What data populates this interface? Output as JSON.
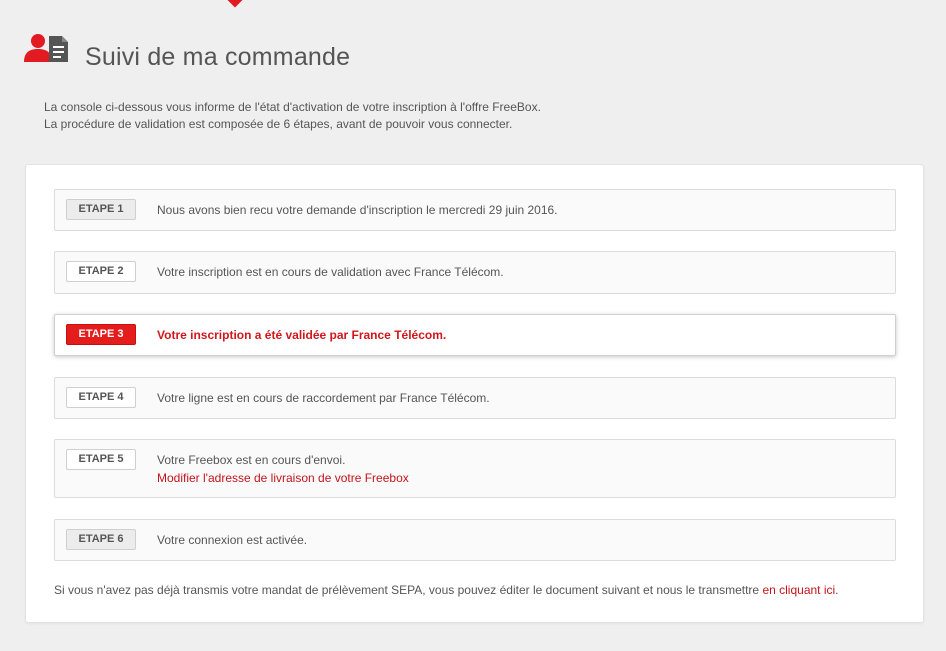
{
  "header": {
    "title": "Suivi de ma commande",
    "icon": "user-document-icon",
    "accent_color": "#e21a22"
  },
  "intro": {
    "line1": "La console ci-dessous vous informe de l'état d'activation de votre inscription à l'offre FreeBox.",
    "line2": "La procédure de validation est composée de 6 étapes, avant de pouvoir vous connecter."
  },
  "steps": [
    {
      "label": "ETAPE 1",
      "text": "Nous avons bien recu votre demande d'inscription le mercredi 29 juin 2016.",
      "state": "done"
    },
    {
      "label": "ETAPE 2",
      "text": "Votre inscription est en cours de validation avec France Télécom.",
      "state": "pending"
    },
    {
      "label": "ETAPE 3",
      "text": "Votre inscription a été validée par France Télécom.",
      "state": "active"
    },
    {
      "label": "ETAPE 4",
      "text": "Votre ligne est en cours de raccordement par France Télécom.",
      "state": "pending"
    },
    {
      "label": "ETAPE 5",
      "text": "Votre Freebox est en cours d'envoi.",
      "link": "Modifier l'adresse de livraison de votre Freebox",
      "state": "pending"
    },
    {
      "label": "ETAPE 6",
      "text": "Votre connexion est activée.",
      "state": "done"
    }
  ],
  "footnote": {
    "text": "Si vous n'avez pas déjà transmis votre mandat de prélèvement SEPA, vous pouvez éditer le document suivant et nous le transmettre ",
    "link": "en cliquant ici",
    "suffix": "."
  }
}
